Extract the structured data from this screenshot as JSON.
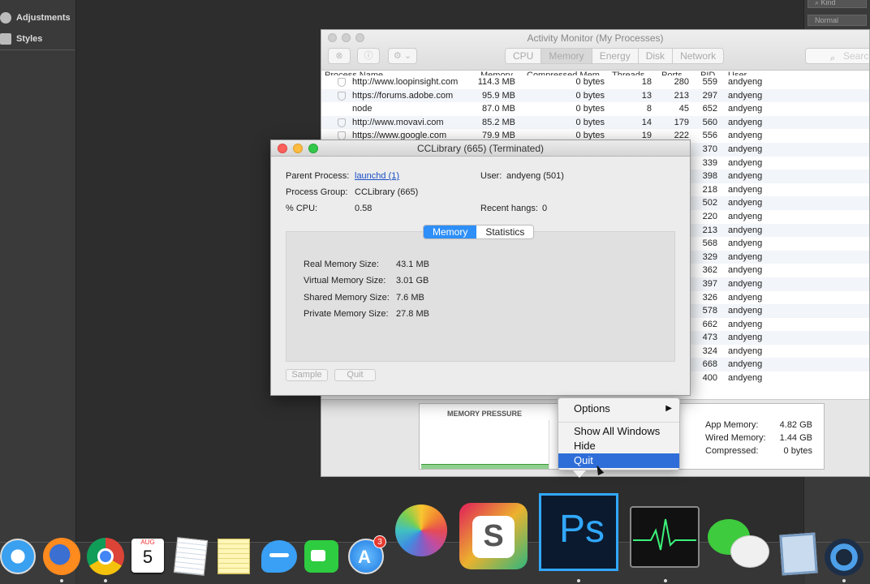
{
  "photoshop": {
    "left_panel": [
      "Adjustments",
      "Styles"
    ],
    "right_panel": {
      "kind_label": "Kind",
      "blend_mode": "Normal"
    }
  },
  "activity_monitor": {
    "title": "Activity Monitor (My Processes)",
    "tabs": [
      "CPU",
      "Memory",
      "Energy",
      "Disk",
      "Network"
    ],
    "active_tab": "Memory",
    "search_placeholder": "Search",
    "columns": [
      "Process Name",
      "Memory",
      "Compressed Mem",
      "Threads",
      "Ports",
      "PID",
      "User"
    ],
    "rows": [
      {
        "name": "http://www.loopinsight.com",
        "memory": "114.3 MB",
        "compressed": "0 bytes",
        "threads": "18",
        "ports": "280",
        "pid": "559",
        "user": "andyeng"
      },
      {
        "name": "https://forums.adobe.com",
        "memory": "95.9 MB",
        "compressed": "0 bytes",
        "threads": "13",
        "ports": "213",
        "pid": "297",
        "user": "andyeng"
      },
      {
        "name": "node",
        "memory": "87.0 MB",
        "compressed": "0 bytes",
        "threads": "8",
        "ports": "45",
        "pid": "652",
        "user": "andyeng"
      },
      {
        "name": "http://www.movavi.com",
        "memory": "85.2 MB",
        "compressed": "0 bytes",
        "threads": "14",
        "ports": "179",
        "pid": "560",
        "user": "andyeng"
      },
      {
        "name": "https://www.google.com",
        "memory": "79.9 MB",
        "compressed": "0 bytes",
        "threads": "19",
        "ports": "222",
        "pid": "556",
        "user": "andyeng"
      },
      {
        "pid": "370",
        "user": "andyeng"
      },
      {
        "pid": "339",
        "user": "andyeng"
      },
      {
        "pid": "398",
        "user": "andyeng"
      },
      {
        "pid": "218",
        "user": "andyeng"
      },
      {
        "pid": "502",
        "user": "andyeng"
      },
      {
        "pid": "220",
        "user": "andyeng"
      },
      {
        "pid": "213",
        "user": "andyeng"
      },
      {
        "pid": "568",
        "user": "andyeng"
      },
      {
        "pid": "329",
        "user": "andyeng"
      },
      {
        "pid": "362",
        "user": "andyeng"
      },
      {
        "pid": "397",
        "user": "andyeng"
      },
      {
        "pid": "326",
        "user": "andyeng"
      },
      {
        "pid": "578",
        "user": "andyeng"
      },
      {
        "pid": "662",
        "user": "andyeng"
      },
      {
        "pid": "473",
        "user": "andyeng"
      },
      {
        "pid": "324",
        "user": "andyeng"
      },
      {
        "pid": "668",
        "user": "andyeng"
      },
      {
        "pid": "400",
        "user": "andyeng"
      }
    ],
    "memory_pressure_label": "MEMORY PRESSURE",
    "stats": [
      {
        "label": "App Memory:",
        "value": "4.82 GB"
      },
      {
        "label": "Wired Memory:",
        "value": "1.44 GB"
      },
      {
        "label": "Compressed:",
        "value": "0 bytes"
      }
    ]
  },
  "inspector": {
    "title": "CCLibrary (665) (Terminated)",
    "parent_process_label": "Parent Process:",
    "parent_process_value": "launchd (1)",
    "user_label": "User:",
    "user_value": "andyeng (501)",
    "process_group_label": "Process Group:",
    "process_group_value": "CCLibrary (665)",
    "cpu_label": "% CPU:",
    "cpu_value": "0.58",
    "recent_hangs_label": "Recent hangs:",
    "recent_hangs_value": "0",
    "tabs": [
      "Memory",
      "Statistics"
    ],
    "memory": [
      {
        "label": "Real Memory Size:",
        "value": "43.1 MB"
      },
      {
        "label": "Virtual Memory Size:",
        "value": "3.01 GB"
      },
      {
        "label": "Shared Memory Size:",
        "value": "7.6 MB"
      },
      {
        "label": "Private Memory Size:",
        "value": "27.8 MB"
      }
    ],
    "sample_label": "Sample",
    "quit_label": "Quit"
  },
  "context_menu": {
    "items": [
      "Options",
      "Show All Windows",
      "Hide",
      "Quit"
    ],
    "selected": "Quit"
  },
  "dock": {
    "calendar_month": "AUG",
    "calendar_day": "5",
    "app_store_badge": "3",
    "photoshop_label": "Ps"
  },
  "colors": {
    "selection": "#2f6ed8",
    "segment_active": "#2d8ff7",
    "memory_pressure_green": "#8ed08e"
  }
}
